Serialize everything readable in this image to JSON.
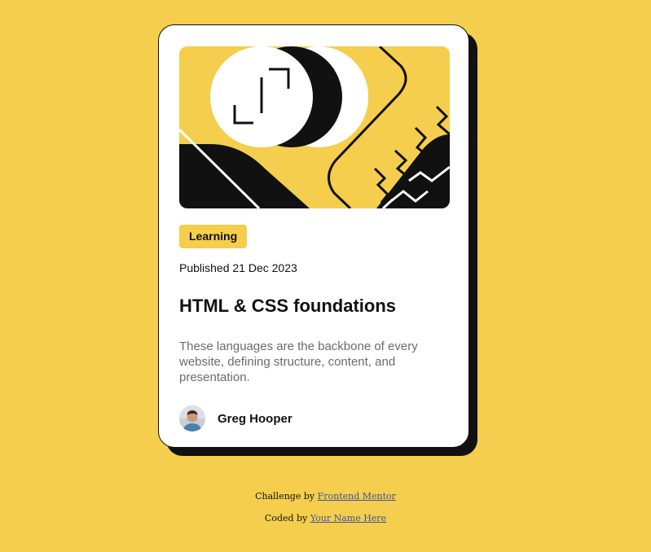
{
  "card": {
    "tag": "Learning",
    "published": "Published 21 Dec 2023",
    "title": "HTML & CSS foundations",
    "description": "These languages are the backbone of every website, defining structure, content, and presentation.",
    "author": {
      "name": "Greg Hooper"
    }
  },
  "attribution": {
    "line1_prefix": "Challenge by",
    "line1_link": "Frontend Mentor",
    "line2_prefix": "Coded by",
    "line2_link": "Your Name Here"
  },
  "colors": {
    "background": "#F4CE4C",
    "ink": "#111111",
    "muted_text": "#6B6B6B",
    "link": "#3E52A3"
  },
  "icons": {
    "hero": "abstract-illustration",
    "avatar": "author-photo"
  }
}
